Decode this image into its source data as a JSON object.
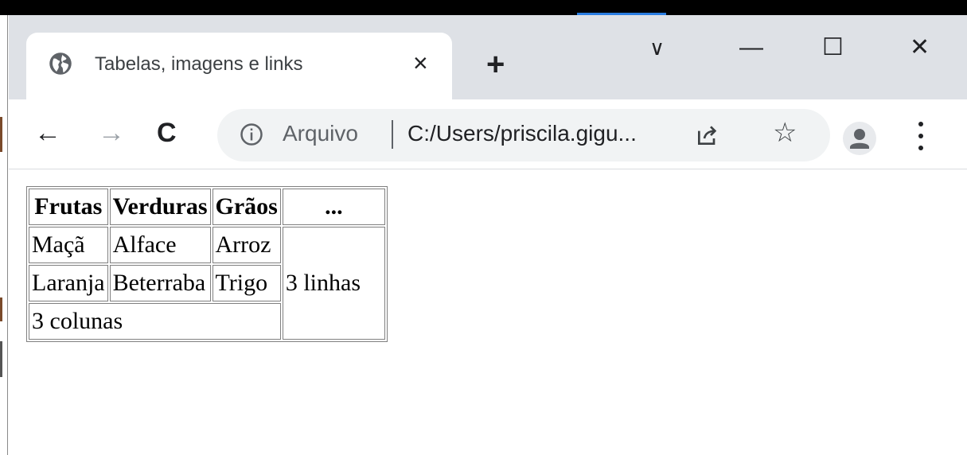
{
  "browser": {
    "tab": {
      "title": "Tabelas, imagens e links",
      "icon": "globe-icon",
      "close_glyph": "×"
    },
    "new_tab_glyph": "+",
    "window_controls": {
      "tab_search_glyph": "∨",
      "minimize_glyph": "—",
      "maximize_glyph": "☐",
      "close_glyph": "✕"
    },
    "nav": {
      "back_glyph": "←",
      "forward_glyph": "→",
      "reload_glyph": "C"
    },
    "omnibox": {
      "scheme_label": "Arquivo",
      "url": "C:/Users/priscila.gigu..."
    },
    "colors": {
      "tabstrip": "#dee1e6",
      "omnibox": "#f1f3f4",
      "accent": "#2a7de1"
    }
  },
  "table": {
    "headers": [
      "Frutas",
      "Verduras",
      "Grãos",
      "..."
    ],
    "rows": [
      [
        "Maçã",
        "Alface",
        "Arroz"
      ],
      [
        "Laranja",
        "Beterraba",
        "Trigo"
      ]
    ],
    "rowspan_cell": "3 linhas",
    "colspan_cell": "3 colunas"
  }
}
